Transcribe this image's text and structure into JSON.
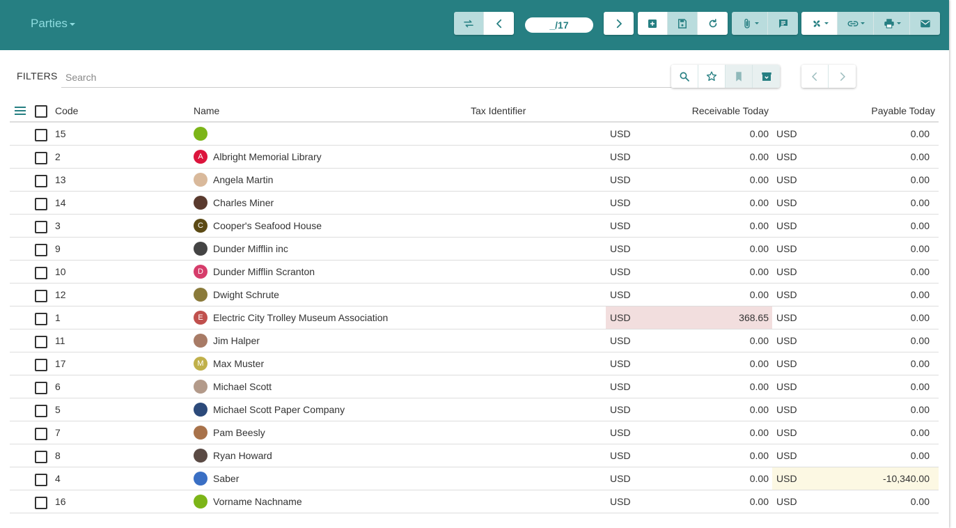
{
  "header": {
    "title": "Parties",
    "pager": "_/17",
    "bg_color": "#267f82"
  },
  "toolbar": {
    "icons": [
      "switch-view-icon",
      "previous-icon",
      "next-icon",
      "new-icon",
      "save-icon",
      "reload-icon",
      "attachment-icon",
      "notes-icon",
      "action-icon",
      "relate-icon",
      "print-icon",
      "email-icon"
    ]
  },
  "filters": {
    "label": "FILTERS",
    "search_placeholder": "Search"
  },
  "table": {
    "columns": {
      "code": "Code",
      "name": "Name",
      "tax": "Tax Identifier",
      "receivable": "Receivable Today",
      "payable": "Payable Today"
    },
    "rows": [
      {
        "code": "15",
        "name": "",
        "initial": "",
        "avatar_color": "#7cb518",
        "rcur": "USD",
        "rval": "0.00",
        "pcur": "USD",
        "pval": "0.00",
        "rstate": "",
        "pstate": ""
      },
      {
        "code": "2",
        "name": "Albright Memorial Library",
        "initial": "A",
        "avatar_color": "#dc143c",
        "rcur": "USD",
        "rval": "0.00",
        "pcur": "USD",
        "pval": "0.00",
        "rstate": "",
        "pstate": ""
      },
      {
        "code": "13",
        "name": "Angela Martin",
        "initial": "",
        "avatar_color": "#d9b99b",
        "rcur": "USD",
        "rval": "0.00",
        "pcur": "USD",
        "pval": "0.00",
        "rstate": "",
        "pstate": ""
      },
      {
        "code": "14",
        "name": "Charles Miner",
        "initial": "",
        "avatar_color": "#5a3a2e",
        "rcur": "USD",
        "rval": "0.00",
        "pcur": "USD",
        "pval": "0.00",
        "rstate": "",
        "pstate": ""
      },
      {
        "code": "3",
        "name": "Cooper's Seafood House",
        "initial": "C",
        "avatar_color": "#5c4a14",
        "rcur": "USD",
        "rval": "0.00",
        "pcur": "USD",
        "pval": "0.00",
        "rstate": "",
        "pstate": ""
      },
      {
        "code": "9",
        "name": "Dunder Mifflin inc",
        "initial": "",
        "avatar_color": "#444444",
        "rcur": "USD",
        "rval": "0.00",
        "pcur": "USD",
        "pval": "0.00",
        "rstate": "",
        "pstate": ""
      },
      {
        "code": "10",
        "name": "Dunder Mifflin Scranton",
        "initial": "D",
        "avatar_color": "#d63d6b",
        "rcur": "USD",
        "rval": "0.00",
        "pcur": "USD",
        "pval": "0.00",
        "rstate": "",
        "pstate": ""
      },
      {
        "code": "12",
        "name": "Dwight Schrute",
        "initial": "",
        "avatar_color": "#8a7a3a",
        "rcur": "USD",
        "rval": "0.00",
        "pcur": "USD",
        "pval": "0.00",
        "rstate": "",
        "pstate": ""
      },
      {
        "code": "1",
        "name": "Electric City Trolley Museum Association",
        "initial": "E",
        "avatar_color": "#c0504d",
        "rcur": "USD",
        "rval": "368.65",
        "pcur": "USD",
        "pval": "0.00",
        "rstate": "danger",
        "pstate": ""
      },
      {
        "code": "11",
        "name": "Jim Halper",
        "initial": "",
        "avatar_color": "#a87b66",
        "rcur": "USD",
        "rval": "0.00",
        "pcur": "USD",
        "pval": "0.00",
        "rstate": "",
        "pstate": ""
      },
      {
        "code": "17",
        "name": "Max Muster",
        "initial": "M",
        "avatar_color": "#c0b04a",
        "rcur": "USD",
        "rval": "0.00",
        "pcur": "USD",
        "pval": "0.00",
        "rstate": "",
        "pstate": ""
      },
      {
        "code": "6",
        "name": "Michael Scott",
        "initial": "",
        "avatar_color": "#b39a8a",
        "rcur": "USD",
        "rval": "0.00",
        "pcur": "USD",
        "pval": "0.00",
        "rstate": "",
        "pstate": ""
      },
      {
        "code": "5",
        "name": "Michael Scott Paper Company",
        "initial": "",
        "avatar_color": "#2c4a7a",
        "rcur": "USD",
        "rval": "0.00",
        "pcur": "USD",
        "pval": "0.00",
        "rstate": "",
        "pstate": ""
      },
      {
        "code": "7",
        "name": "Pam Beesly",
        "initial": "",
        "avatar_color": "#a8724a",
        "rcur": "USD",
        "rval": "0.00",
        "pcur": "USD",
        "pval": "0.00",
        "rstate": "",
        "pstate": ""
      },
      {
        "code": "8",
        "name": "Ryan Howard",
        "initial": "",
        "avatar_color": "#5a4a44",
        "rcur": "USD",
        "rval": "0.00",
        "pcur": "USD",
        "pval": "0.00",
        "rstate": "",
        "pstate": ""
      },
      {
        "code": "4",
        "name": "Saber",
        "initial": "",
        "avatar_color": "#3a6fc4",
        "rcur": "USD",
        "rval": "0.00",
        "pcur": "USD",
        "pval": "-10,340.00",
        "rstate": "",
        "pstate": "warning"
      },
      {
        "code": "16",
        "name": "Vorname Nachname",
        "initial": "",
        "avatar_color": "#7cb518",
        "rcur": "USD",
        "rval": "0.00",
        "pcur": "USD",
        "pval": "0.00",
        "rstate": "",
        "pstate": ""
      }
    ]
  }
}
